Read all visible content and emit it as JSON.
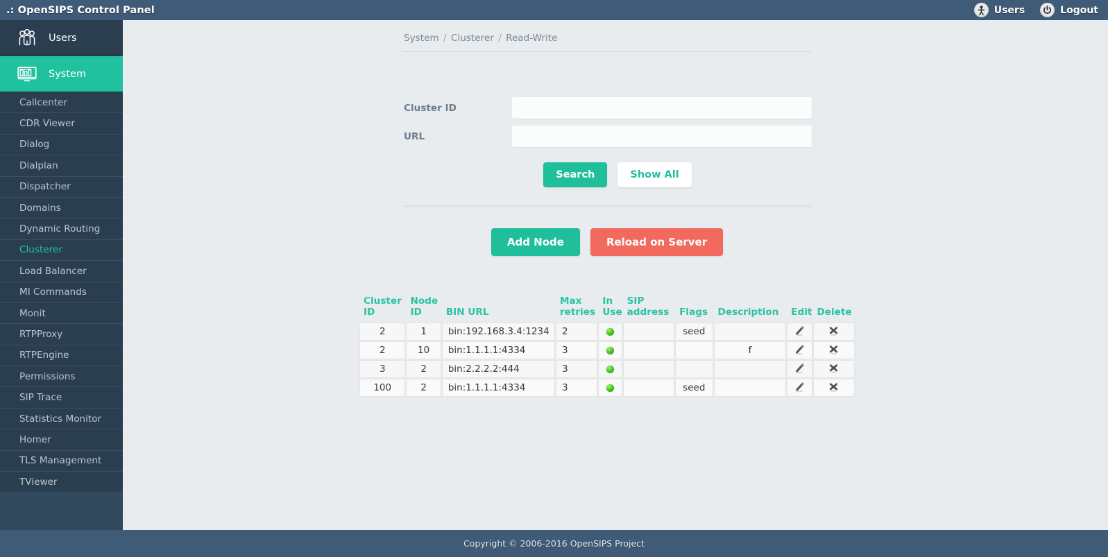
{
  "header": {
    "title": ".: OpenSIPS Control Panel",
    "users_label": "Users",
    "logout_label": "Logout"
  },
  "sidebar": {
    "primary": [
      {
        "label": "Users",
        "icon": "users-group-icon",
        "active": false
      },
      {
        "label": "System",
        "icon": "system-monitor-icon",
        "active": true
      }
    ],
    "items": [
      {
        "label": "Callcenter",
        "current": false
      },
      {
        "label": "CDR Viewer",
        "current": false
      },
      {
        "label": "Dialog",
        "current": false
      },
      {
        "label": "Dialplan",
        "current": false
      },
      {
        "label": "Dispatcher",
        "current": false
      },
      {
        "label": "Domains",
        "current": false
      },
      {
        "label": "Dynamic Routing",
        "current": false
      },
      {
        "label": "Clusterer",
        "current": true
      },
      {
        "label": "Load Balancer",
        "current": false
      },
      {
        "label": "MI Commands",
        "current": false
      },
      {
        "label": "Monit",
        "current": false
      },
      {
        "label": "RTPProxy",
        "current": false
      },
      {
        "label": "RTPEngine",
        "current": false
      },
      {
        "label": "Permissions",
        "current": false
      },
      {
        "label": "SIP Trace",
        "current": false
      },
      {
        "label": "Statistics Monitor",
        "current": false
      },
      {
        "label": "Homer",
        "current": false
      },
      {
        "label": "TLS Management",
        "current": false
      },
      {
        "label": "TViewer",
        "current": false
      }
    ]
  },
  "breadcrumb": {
    "parts": [
      "System",
      "Clusterer",
      "Read-Write"
    ],
    "separator": "/"
  },
  "search_form": {
    "fields": [
      {
        "label": "Cluster ID",
        "value": "",
        "placeholder": ""
      },
      {
        "label": "URL",
        "value": "",
        "placeholder": ""
      }
    ],
    "search_label": "Search",
    "show_all_label": "Show All"
  },
  "actions": {
    "add_node_label": "Add Node",
    "reload_label": "Reload on Server"
  },
  "table": {
    "columns": [
      "Cluster ID",
      "Node ID",
      "BIN URL",
      "Max retries",
      "In Use",
      "SIP address",
      "Flags",
      "Description",
      "Edit",
      "Delete"
    ],
    "rows": [
      {
        "cluster_id": "2",
        "node_id": "1",
        "bin_url": "bin:192.168.3.4:1234",
        "max_retries": "2",
        "in_use": "on",
        "sip_address": "",
        "flags": "seed",
        "description": "",
        "edit_icon": "pencil-icon",
        "delete_icon": "cross-icon"
      },
      {
        "cluster_id": "2",
        "node_id": "10",
        "bin_url": "bin:1.1.1.1:4334",
        "max_retries": "3",
        "in_use": "on",
        "sip_address": "",
        "flags": "",
        "description": "f",
        "edit_icon": "pencil-icon",
        "delete_icon": "cross-icon"
      },
      {
        "cluster_id": "3",
        "node_id": "2",
        "bin_url": "bin:2.2.2.2:444",
        "max_retries": "3",
        "in_use": "on",
        "sip_address": "",
        "flags": "",
        "description": "",
        "edit_icon": "pencil-icon",
        "delete_icon": "cross-icon"
      },
      {
        "cluster_id": "100",
        "node_id": "2",
        "bin_url": "bin:1.1.1.1:4334",
        "max_retries": "3",
        "in_use": "on",
        "sip_address": "",
        "flags": "seed",
        "description": "",
        "edit_icon": "pencil-icon",
        "delete_icon": "cross-icon"
      }
    ]
  },
  "footer": {
    "copyright": "Copyright © 2006-2016 OpenSIPS Project"
  },
  "colors": {
    "accent_green": "#20c19e",
    "header_blue": "#3f5b77",
    "sidebar_dark": "#2b3e50",
    "danger_red": "#f2695e",
    "page_bg": "#e8ecef"
  }
}
